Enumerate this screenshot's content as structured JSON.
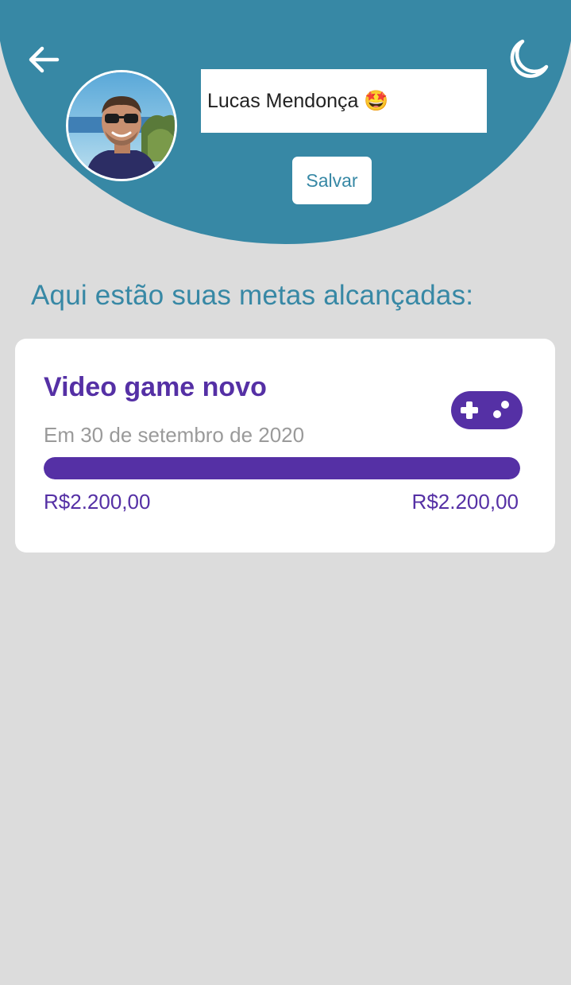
{
  "header": {
    "user_name": "Lucas Mendonça 🤩",
    "save_label": "Salvar",
    "colors": {
      "header_bg": "#3788a5",
      "page_bg": "#dcdcdc"
    },
    "icons": {
      "back": "arrow-left-icon",
      "theme": "moon-icon",
      "avatar": "user-photo"
    }
  },
  "main": {
    "section_title": "Aqui estão suas metas alcançadas:",
    "goals": [
      {
        "title": "Video game novo",
        "date": "Em 30 de setembro de 2020",
        "current_amount": "R$2.200,00",
        "target_amount": "R$2.200,00",
        "progress": 1.0,
        "icon": "gamepad-icon",
        "accent_color": "#5530a5"
      }
    ]
  }
}
